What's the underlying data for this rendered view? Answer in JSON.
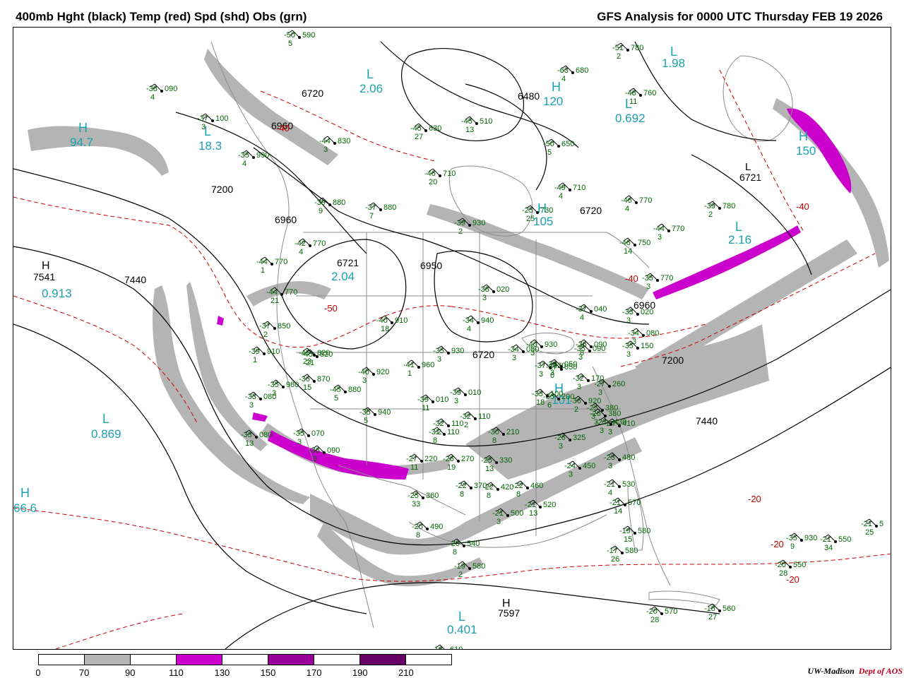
{
  "header": {
    "title_left": "400mb Hght (black) Temp (red) Spd (shd) Obs (grn)",
    "title_right": "GFS Analysis for 0000 UTC Thursday  FEB 19 2026"
  },
  "colors": {
    "height_contour": "#000000",
    "temperature_contour": "#cc0000",
    "speed_70_90": "#b4b4b4",
    "speed_110_130": "#cc00cc",
    "speed_150_170": "#990099",
    "speed_190_210": "#660066",
    "observations": "#006600",
    "centers": "#1aa0b0",
    "map_lines": "#8c8c8c"
  },
  "legend": {
    "labels": [
      "0",
      "70",
      "90",
      "110",
      "130",
      "150",
      "170",
      "190",
      "210"
    ],
    "boxes": [
      "#ffffff",
      "#b4b4b4",
      "#ffffff",
      "#cc00cc",
      "#ffffff",
      "#990099",
      "#ffffff",
      "#660066",
      "#ffffff"
    ]
  },
  "credit": {
    "org": "UW-Madison",
    "dept": "Dept of AOS"
  },
  "map": {
    "height_labels": [
      "6720",
      "6960",
      "7200",
      "7440",
      "6480",
      "6720",
      "6960",
      "7200",
      "7440",
      "6721",
      "6950",
      "6960",
      "6721",
      "6720",
      "6960"
    ],
    "temperature_labels": [
      "-40",
      "-40",
      "-50",
      "-40",
      "-20",
      "-20",
      "-20"
    ],
    "centers": [
      {
        "letter": "H",
        "value": "7541"
      },
      {
        "letter": "L",
        "value": "0.913"
      },
      {
        "letter": "L",
        "value": "0.869"
      },
      {
        "letter": "H",
        "value": "66.6"
      },
      {
        "letter": "L",
        "value": "18.3"
      },
      {
        "letter": "H",
        "value": "94.7"
      },
      {
        "letter": "L",
        "value": "2.06"
      },
      {
        "letter": "L",
        "value": "2.04"
      },
      {
        "letter": "H",
        "value": "120"
      },
      {
        "letter": "L",
        "value": "0.692"
      },
      {
        "letter": "L",
        "value": "1.98"
      },
      {
        "letter": "H",
        "value": "150"
      },
      {
        "letter": "L",
        "value": "2.16"
      },
      {
        "letter": "H",
        "value": "105"
      },
      {
        "letter": "H",
        "value": "7597"
      },
      {
        "letter": "L",
        "value": "0.401"
      },
      {
        "letter": "H",
        "value": "101"
      },
      {
        "letter": "L",
        "value": "6721"
      }
    ],
    "observations": [
      {
        "t": "-50",
        "h": "590",
        "d": "5"
      },
      {
        "t": "-38",
        "h": "090",
        "d": "4"
      },
      {
        "t": "-37",
        "h": "100",
        "d": "3"
      },
      {
        "t": "-35",
        "h": "990",
        "d": "4"
      },
      {
        "t": "-39",
        "h": "880",
        "d": "9"
      },
      {
        "t": "-37",
        "h": "880",
        "d": "7"
      },
      {
        "t": "-42",
        "h": "770",
        "d": "4"
      },
      {
        "t": "-44",
        "h": "770",
        "d": "1"
      },
      {
        "t": "-44",
        "h": "770",
        "d": "21"
      },
      {
        "t": "-37",
        "h": "850",
        "d": "2"
      },
      {
        "t": "-39",
        "h": "910",
        "d": "1"
      },
      {
        "t": "-45",
        "h": "820",
        "d": "21"
      },
      {
        "t": "-36",
        "h": "870",
        "d": "15"
      },
      {
        "t": "-45",
        "h": "880",
        "d": "5"
      },
      {
        "t": "-40",
        "h": "920",
        "d": "3"
      },
      {
        "t": "-41",
        "h": "960",
        "d": "1"
      },
      {
        "t": "-40",
        "h": "910",
        "d": "18"
      },
      {
        "t": "-35",
        "h": "930",
        "d": "3"
      },
      {
        "t": "-34",
        "h": "940",
        "d": "4"
      },
      {
        "t": "-39",
        "h": "010",
        "d": "11"
      },
      {
        "t": "-39",
        "h": "010",
        "d": "3"
      },
      {
        "t": "-35",
        "h": "940",
        "d": "5"
      },
      {
        "t": "-32",
        "h": "110",
        "d": "2"
      },
      {
        "t": "-31",
        "h": "110",
        "d": "8"
      },
      {
        "t": "-30",
        "h": "210",
        "d": "8"
      },
      {
        "t": "-27",
        "h": "220",
        "d": "11"
      },
      {
        "t": "-26",
        "h": "270",
        "d": "19"
      },
      {
        "t": "-25",
        "h": "330",
        "d": "13"
      },
      {
        "t": "-22",
        "h": "370",
        "d": "8"
      },
      {
        "t": "-22",
        "h": "420",
        "d": "8"
      },
      {
        "t": "-22",
        "h": "460",
        "d": "8"
      },
      {
        "t": "-21",
        "h": "500",
        "d": "3"
      },
      {
        "t": "-21",
        "h": "520",
        "d": "13"
      },
      {
        "t": "-21",
        "h": "530",
        "d": "4"
      },
      {
        "t": "-21",
        "h": "570",
        "d": "14"
      },
      {
        "t": "-19",
        "h": "580",
        "d": "15"
      },
      {
        "t": "-17",
        "h": "580",
        "d": "26"
      },
      {
        "t": "-20",
        "h": "540",
        "d": "8"
      },
      {
        "t": "-19",
        "h": "580",
        "d": "2"
      },
      {
        "t": "-20",
        "h": "490",
        "d": "8"
      },
      {
        "t": "-25",
        "h": "360",
        "d": "33"
      },
      {
        "t": "-36",
        "h": "920",
        "d": "2"
      },
      {
        "t": "-30",
        "h": "200",
        "d": "6"
      },
      {
        "t": "-36",
        "h": "090",
        "d": "8"
      },
      {
        "t": "-34",
        "h": "080",
        "d": "3"
      },
      {
        "t": "-48",
        "h": "760",
        "d": "11"
      },
      {
        "t": "-51",
        "h": "780",
        "d": "2"
      },
      {
        "t": "-63",
        "h": "680",
        "d": "4"
      },
      {
        "t": "-50",
        "h": "650",
        "d": "5"
      },
      {
        "t": "-49",
        "h": "710",
        "d": "4"
      },
      {
        "t": "-46",
        "h": "770",
        "d": "4"
      },
      {
        "t": "-46",
        "h": "750",
        "d": "14"
      },
      {
        "t": "-44",
        "h": "770",
        "d": "3"
      },
      {
        "t": "-39",
        "h": "780",
        "d": "2"
      },
      {
        "t": "-46",
        "h": "710",
        "d": "20"
      },
      {
        "t": "-25",
        "h": "730",
        "d": "25"
      },
      {
        "t": "-45",
        "h": "510",
        "d": "13"
      },
      {
        "t": "-45",
        "h": "630",
        "d": "27"
      },
      {
        "t": "-44",
        "h": "830",
        "d": "3"
      },
      {
        "t": "-20",
        "h": "570",
        "d": "28"
      },
      {
        "t": "-18",
        "h": "560",
        "d": "27"
      },
      {
        "t": "-20",
        "h": "550",
        "d": "28"
      },
      {
        "t": "-21",
        "h": "550",
        "d": "34"
      },
      {
        "t": "-21",
        "h": "5",
        "d": "25"
      },
      {
        "t": "-18",
        "h": "610",
        "d": ""
      },
      {
        "t": "-23",
        "h": "480",
        "d": "3"
      },
      {
        "t": "-24",
        "h": "410",
        "d": "3"
      },
      {
        "t": "-25",
        "h": "380",
        "d": "3"
      },
      {
        "t": "-26",
        "h": "380",
        "d": "3"
      },
      {
        "t": "-27",
        "h": "260",
        "d": "3"
      },
      {
        "t": "-32",
        "h": "170",
        "d": "3"
      },
      {
        "t": "-33",
        "h": "050",
        "d": "3"
      },
      {
        "t": "-35",
        "h": "090",
        "d": "3"
      },
      {
        "t": "-35",
        "h": "150",
        "d": "3"
      },
      {
        "t": "-34",
        "h": "080",
        "d": "3"
      },
      {
        "t": "-37",
        "h": "040",
        "d": "4"
      },
      {
        "t": "-35",
        "h": "770",
        "d": "3"
      },
      {
        "t": "-45",
        "h": "820",
        "d": "23"
      },
      {
        "t": "-39",
        "h": "930",
        "d": "2"
      },
      {
        "t": "-38",
        "h": "020",
        "d": "3"
      },
      {
        "t": "-33",
        "h": "020",
        "d": "3"
      },
      {
        "t": "-40",
        "h": "930",
        "d": "3"
      },
      {
        "t": "-37",
        "h": "020",
        "d": "3"
      },
      {
        "t": "-37",
        "h": "050",
        "d": "0"
      },
      {
        "t": "-33",
        "h": "100",
        "d": "18"
      },
      {
        "t": "-24",
        "h": "450",
        "d": "3"
      },
      {
        "t": "-23",
        "h": "430",
        "d": "3"
      },
      {
        "t": "-26",
        "h": "325",
        "d": "3"
      },
      {
        "t": "-32",
        "h": "110",
        "d": "2"
      },
      {
        "t": "-35",
        "h": "070",
        "d": "3"
      },
      {
        "t": "-36",
        "h": "090",
        "d": "3"
      },
      {
        "t": "-33",
        "h": "080",
        "d": "3"
      },
      {
        "t": "-35",
        "h": "980",
        "d": "3"
      },
      {
        "t": "-33",
        "h": "080",
        "d": "13"
      },
      {
        "t": "-35",
        "h": "930",
        "d": "9"
      }
    ]
  }
}
